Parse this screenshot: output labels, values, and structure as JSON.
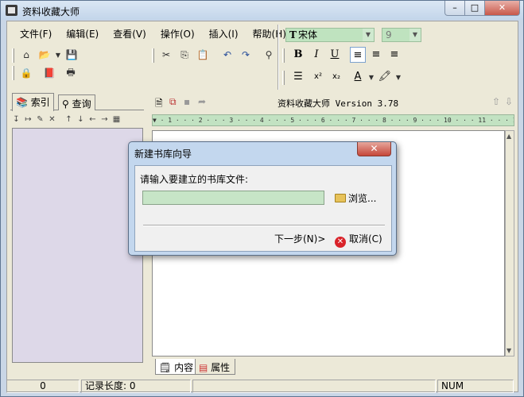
{
  "window": {
    "title": "资料收藏大师",
    "controls": {
      "minimize": "–",
      "maximize": "□",
      "close": "✕"
    }
  },
  "menu": [
    "文件(F)",
    "编辑(E)",
    "查看(V)",
    "操作(O)",
    "插入(I)",
    "帮助(H)"
  ],
  "format_toolbar": {
    "font_prefix": "T",
    "font": "宋体",
    "size": "9",
    "bold": "B",
    "italic": "I",
    "underline": "U",
    "superscript": "x²",
    "subscript": "x₂",
    "font_color": "A"
  },
  "left_tabs": {
    "index": "索引",
    "query": "查询"
  },
  "list_toolbar": [
    "↧",
    "↦",
    "✎",
    "✕",
    "↑",
    "↓",
    "←",
    "→",
    "▦"
  ],
  "document": {
    "title": "资料收藏大师 Version 3.78",
    "ruler": "▼ · 1 · · · 2 · · · 3 · · · 4 · · · 5 · · · 6 · · · 7 · · · 8 · · · 9 · · · 10 · · · 11 · · · 12 · · ·"
  },
  "bottom_tabs": {
    "content": "内容",
    "properties": "属性"
  },
  "status": {
    "left_value": "0",
    "record_length_label": "记录长度: 0",
    "num": "NUM"
  },
  "dialog": {
    "title": "新建书库向导",
    "close": "✕",
    "prompt": "请输入要建立的书库文件:",
    "input_value": "",
    "browse": "浏览...",
    "next": "下一步(N)>",
    "cancel": "取消(C)"
  },
  "icons": {
    "new": "new-record-icon",
    "open": "open-folder-icon",
    "save": "save-disk-icon",
    "cut": "cut-icon",
    "copy": "copy-icon",
    "paste": "paste-icon",
    "undo": "undo-icon",
    "redo": "redo-icon",
    "find": "binoculars-icon",
    "print": "printer-icon"
  }
}
